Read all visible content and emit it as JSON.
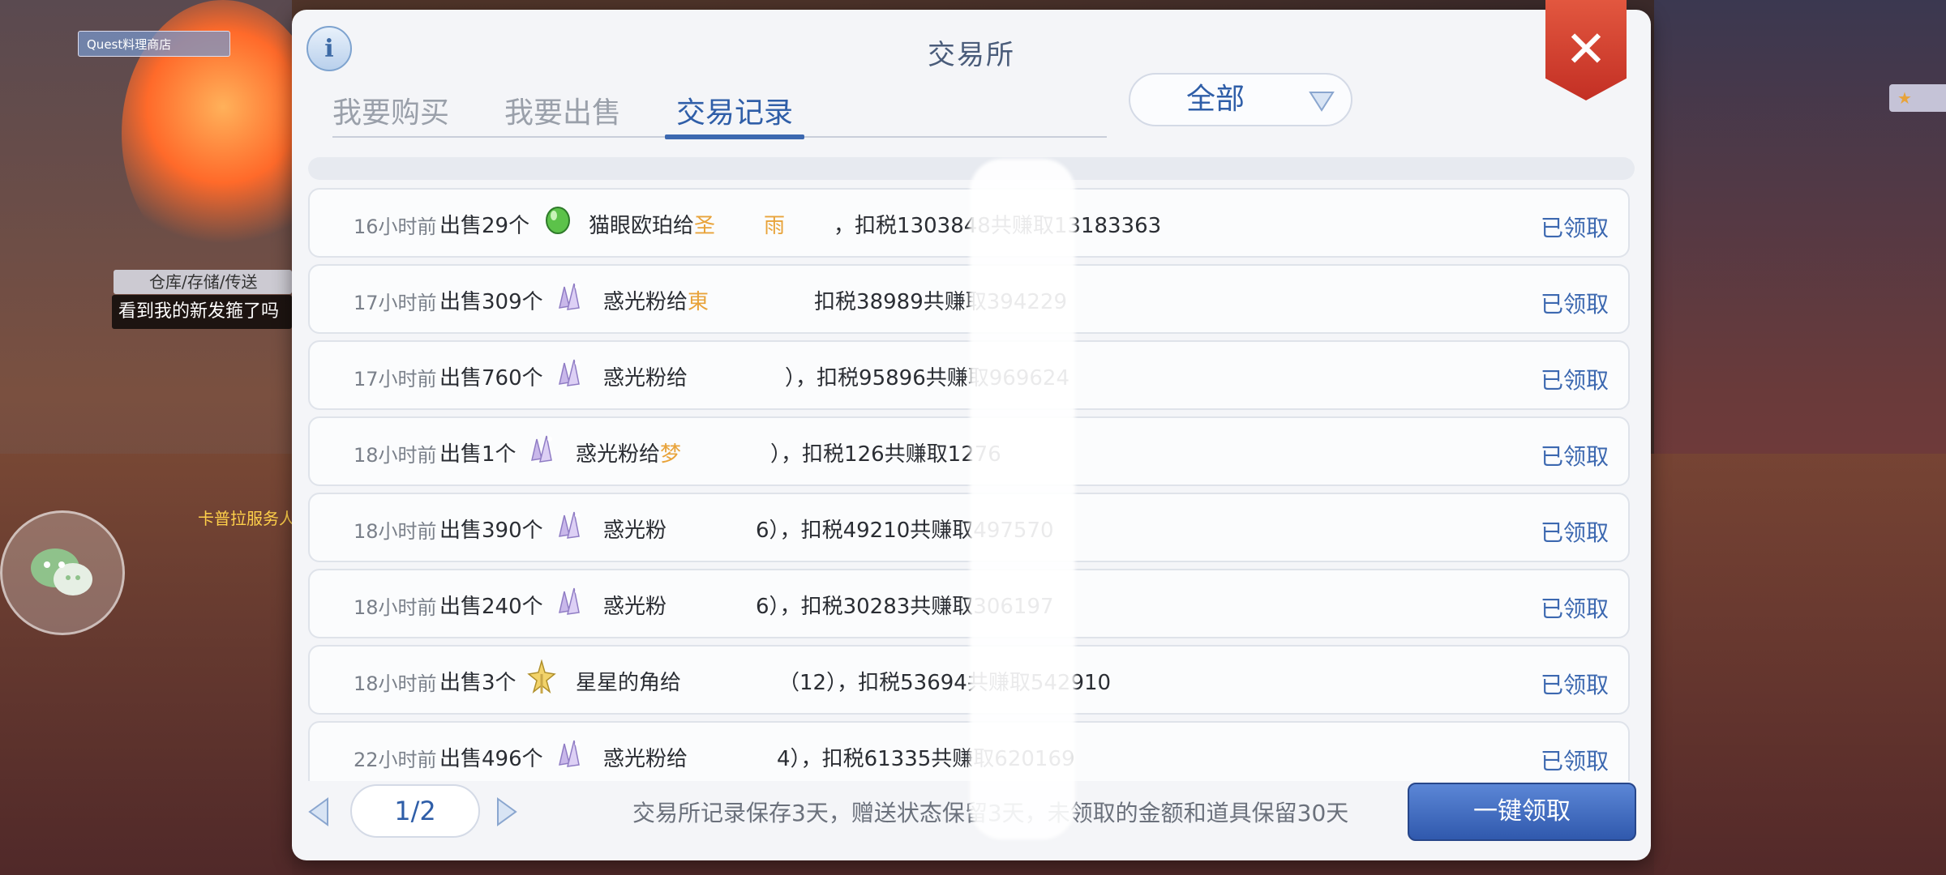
{
  "background": {
    "npc_shop_tag": "Quest料理商店",
    "warehouse_tag": "仓库/存储/传送",
    "chat_bubble": "看到我的新发箍了吗",
    "npc_name": "卡普拉服务人员"
  },
  "dialog": {
    "title": "交易所",
    "tabs": [
      {
        "label": "我要购买",
        "active": false
      },
      {
        "label": "我要出售",
        "active": false
      },
      {
        "label": "交易记录",
        "active": true
      }
    ],
    "filter": {
      "selected": "全部"
    },
    "records": [
      {
        "time": "16小时前",
        "sold": "出售29个",
        "icon": "green-gem-icon",
        "desc_main": "猫眼欧珀给",
        "desc_highlight": "圣",
        "desc_tail": "雨",
        "desc_tax": "，扣税1303848共赚取13183363",
        "status": "已领取"
      },
      {
        "time": "17小时前",
        "sold": "出售309个",
        "icon": "crystal-powder-icon",
        "desc_main": "惑光粉给",
        "desc_highlight": "東",
        "desc_tail": "",
        "desc_tax": "扣税38989共赚取394229",
        "status": "已领取"
      },
      {
        "time": "17小时前",
        "sold": "出售760个",
        "icon": "crystal-powder-icon",
        "desc_main": "惑光粉给",
        "desc_highlight": "",
        "desc_tail": "）",
        "desc_tax": "，扣税95896共赚取969624",
        "status": "已领取"
      },
      {
        "time": "18小时前",
        "sold": "出售1个",
        "icon": "crystal-powder-icon",
        "desc_main": "惑光粉给",
        "desc_highlight": "梦",
        "desc_tail": "）",
        "desc_tax": "，扣税126共赚取1276",
        "status": "已领取"
      },
      {
        "time": "18小时前",
        "sold": "出售390个",
        "icon": "crystal-powder-icon",
        "desc_main": "惑光粉",
        "desc_highlight": "",
        "desc_tail": "6）",
        "desc_tax": "，扣税49210共赚取497570",
        "status": "已领取"
      },
      {
        "time": "18小时前",
        "sold": "出售240个",
        "icon": "crystal-powder-icon",
        "desc_main": "惑光粉",
        "desc_highlight": "",
        "desc_tail": "6）",
        "desc_tax": "，扣税30283共赚取306197",
        "status": "已领取"
      },
      {
        "time": "18小时前",
        "sold": "出售3个",
        "icon": "star-horn-icon",
        "desc_main": "星星的角给",
        "desc_highlight": "",
        "desc_tail": "（12）",
        "desc_tax": "，扣税53694共赚取542910",
        "status": "已领取"
      },
      {
        "time": "22小时前",
        "sold": "出售496个",
        "icon": "crystal-powder-icon",
        "desc_main": "惑光粉给",
        "desc_highlight": "",
        "desc_tail": "4）",
        "desc_tax": "，扣税61335共赚取620169",
        "status": "已领取"
      }
    ],
    "pager": {
      "page": "1/2"
    },
    "footer_note": "交易所记录保存3天，赠送状态保留3天，未领取的金额和道具保留30天",
    "claim_all_label": "一键领取",
    "colors": {
      "accent": "#2f5ea8",
      "highlight": "#e8a33a",
      "close": "#d9412f"
    }
  }
}
